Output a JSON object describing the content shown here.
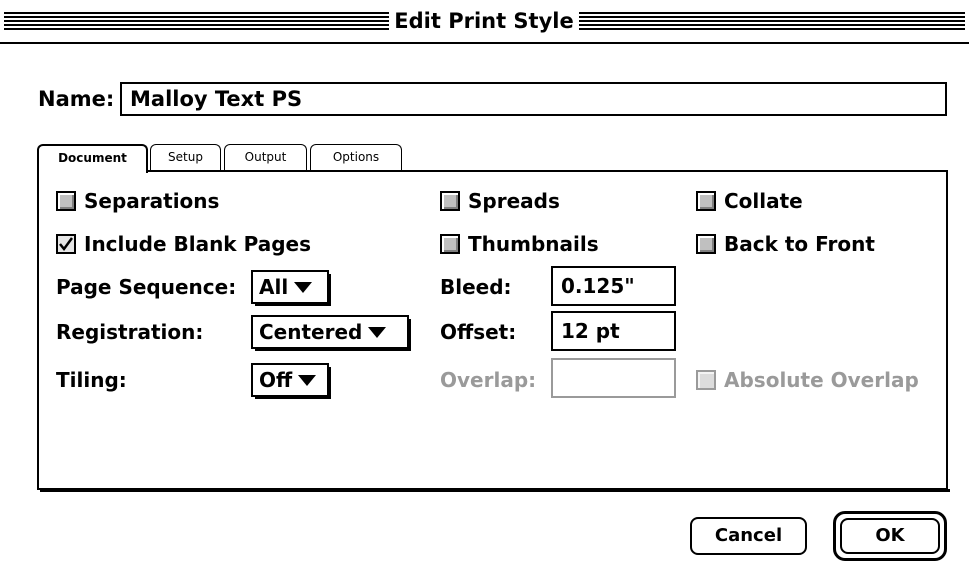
{
  "window": {
    "title": "Edit Print Style"
  },
  "name_field": {
    "label": "Name:",
    "value": "Malloy Text PS"
  },
  "tabs": [
    {
      "label": "Document",
      "active": true
    },
    {
      "label": "Setup",
      "active": false
    },
    {
      "label": "Output",
      "active": false
    },
    {
      "label": "Options",
      "active": false
    }
  ],
  "document": {
    "separations": {
      "label": "Separations",
      "checked": false
    },
    "include_blank_pages": {
      "label": "Include Blank Pages",
      "checked": true
    },
    "spreads": {
      "label": "Spreads",
      "checked": false
    },
    "thumbnails": {
      "label": "Thumbnails",
      "checked": false
    },
    "collate": {
      "label": "Collate",
      "checked": false
    },
    "back_to_front": {
      "label": "Back to Front",
      "checked": false
    },
    "page_sequence": {
      "label": "Page Sequence:",
      "value": "All"
    },
    "registration": {
      "label": "Registration:",
      "value": "Centered"
    },
    "tiling": {
      "label": "Tiling:",
      "value": "Off"
    },
    "bleed": {
      "label": "Bleed:",
      "value": "0.125\""
    },
    "offset": {
      "label": "Offset:",
      "value": "12  pt"
    },
    "overlap": {
      "label": "Overlap:",
      "value": "",
      "disabled": true
    },
    "absolute_overlap": {
      "label": "Absolute Overlap",
      "checked": false,
      "disabled": true
    }
  },
  "buttons": {
    "cancel": "Cancel",
    "ok": "OK"
  }
}
